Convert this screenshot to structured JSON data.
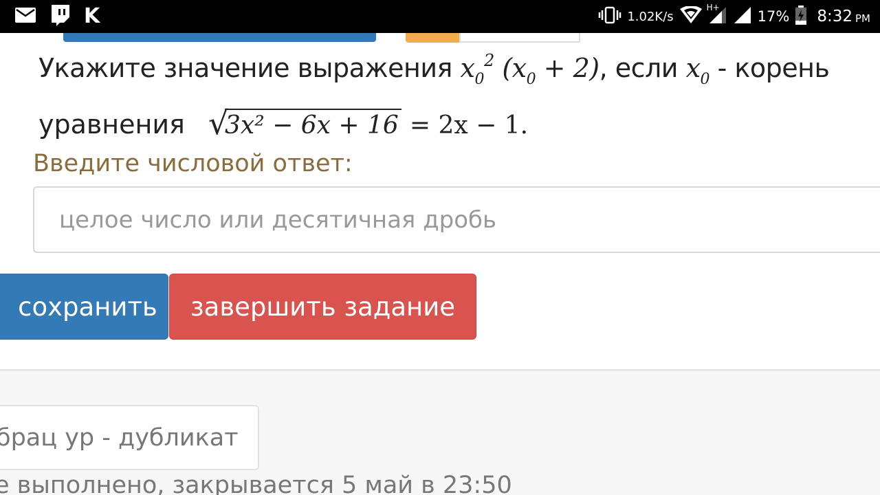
{
  "status_bar": {
    "speed": "1.02K/s",
    "network": "H+",
    "battery": "17%",
    "time": "8:32",
    "ampm": "PM"
  },
  "problem": {
    "text_start": "Укажите значение выражения",
    "text_esli": ", если",
    "text_koren": "- корень",
    "text_uravneniya": "уравнения",
    "var": "x",
    "sub": "0",
    "sup": "2",
    "paren_expr": "+ 2)",
    "radicand": "3x² − 6x + 16",
    "rhs": "= 2x − 1."
  },
  "answer": {
    "label": "Введите числовой ответ:",
    "placeholder": "целое число или десятичная дробь"
  },
  "buttons": {
    "save": "сохранить",
    "finish": "завершить задание"
  },
  "lower": {
    "duplicate": "брац ур - дубликат",
    "deadline": "е выполнено, закрывается 5 май в 23:50"
  }
}
